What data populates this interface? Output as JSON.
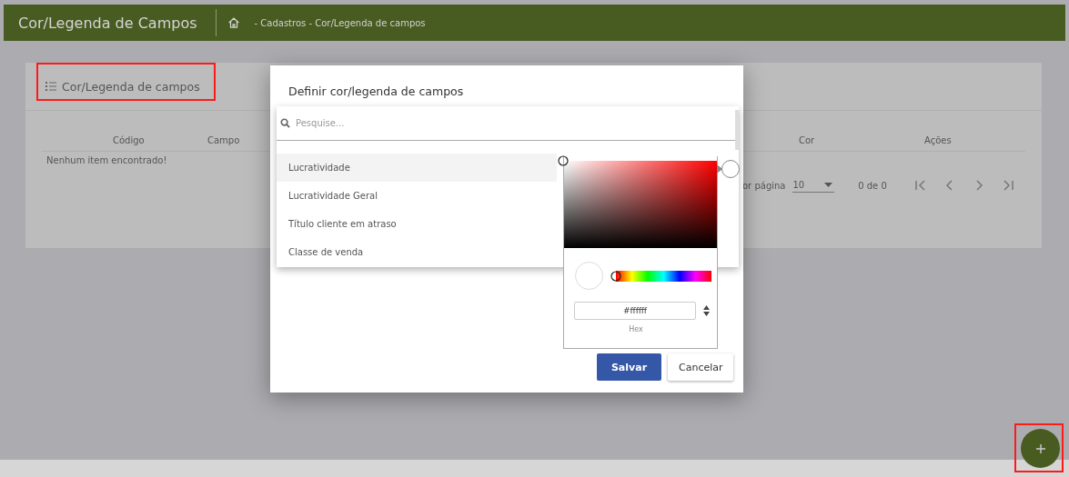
{
  "header": {
    "title": "Cor/Legenda de Campos",
    "breadcrumb": "- Cadastros - Cor/Legenda de campos"
  },
  "card": {
    "title": "Cor/Legenda de campos",
    "columns": [
      {
        "label": "Código"
      },
      {
        "label": "Campo"
      },
      {
        "label": "Cor"
      },
      {
        "label": "Ações"
      }
    ],
    "empty_message": "Nenhum item encontrado!",
    "paginator": {
      "items_per_page_label": "or página",
      "page_size": "10",
      "range": "0 de 0"
    }
  },
  "modal": {
    "title": "Definir cor/legenda de campos",
    "search_placeholder": "Pesquise...",
    "options": [
      {
        "label": "Lucratividade",
        "selected": true
      },
      {
        "label": "Lucratividade Geral",
        "selected": false
      },
      {
        "label": "Título cliente em atraso",
        "selected": false
      },
      {
        "label": "Classe de venda",
        "selected": false
      }
    ],
    "color_picker": {
      "hex": "#ffffff",
      "hex_label": "Hex",
      "hue": {
        "level": 0
      }
    },
    "buttons": [
      {
        "label": "Salvar",
        "kind": "primary"
      },
      {
        "label": "Cancelar",
        "kind": "secondary"
      }
    ]
  }
}
